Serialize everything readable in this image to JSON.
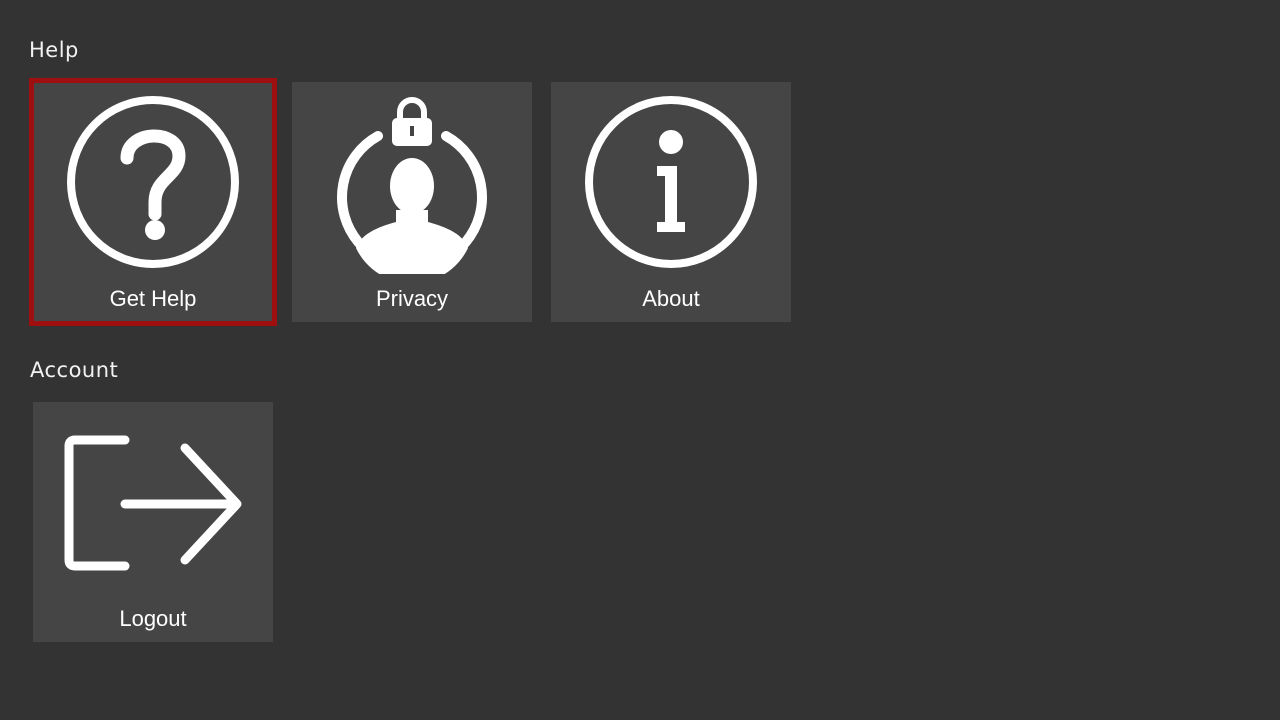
{
  "sections": [
    {
      "title": "Help",
      "tiles": [
        {
          "label": "Get Help",
          "icon": "question-circle-icon",
          "focused": true
        },
        {
          "label": "Privacy",
          "icon": "privacy-user-lock-icon",
          "focused": false
        },
        {
          "label": "About",
          "icon": "info-circle-icon",
          "focused": false
        }
      ]
    },
    {
      "title": "Account",
      "tiles": [
        {
          "label": "Logout",
          "icon": "logout-arrow-icon",
          "focused": false
        }
      ]
    }
  ],
  "colors": {
    "background": "#333333",
    "tile": "#454545",
    "focus_border": "#a00f0f",
    "icon": "#ffffff"
  }
}
